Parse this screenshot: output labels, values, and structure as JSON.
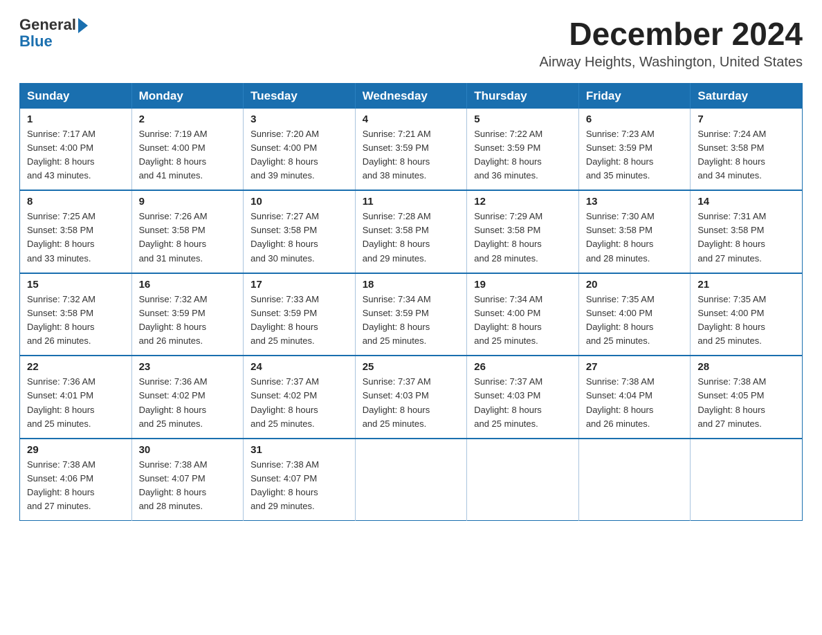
{
  "header": {
    "logo": {
      "general": "General",
      "blue": "Blue",
      "triangle": "▶"
    },
    "title": "December 2024",
    "subtitle": "Airway Heights, Washington, United States"
  },
  "calendar": {
    "days_of_week": [
      "Sunday",
      "Monday",
      "Tuesday",
      "Wednesday",
      "Thursday",
      "Friday",
      "Saturday"
    ],
    "weeks": [
      [
        {
          "day": "1",
          "sunrise": "Sunrise: 7:17 AM",
          "sunset": "Sunset: 4:00 PM",
          "daylight": "Daylight: 8 hours and 43 minutes."
        },
        {
          "day": "2",
          "sunrise": "Sunrise: 7:19 AM",
          "sunset": "Sunset: 4:00 PM",
          "daylight": "Daylight: 8 hours and 41 minutes."
        },
        {
          "day": "3",
          "sunrise": "Sunrise: 7:20 AM",
          "sunset": "Sunset: 4:00 PM",
          "daylight": "Daylight: 8 hours and 39 minutes."
        },
        {
          "day": "4",
          "sunrise": "Sunrise: 7:21 AM",
          "sunset": "Sunset: 3:59 PM",
          "daylight": "Daylight: 8 hours and 38 minutes."
        },
        {
          "day": "5",
          "sunrise": "Sunrise: 7:22 AM",
          "sunset": "Sunset: 3:59 PM",
          "daylight": "Daylight: 8 hours and 36 minutes."
        },
        {
          "day": "6",
          "sunrise": "Sunrise: 7:23 AM",
          "sunset": "Sunset: 3:59 PM",
          "daylight": "Daylight: 8 hours and 35 minutes."
        },
        {
          "day": "7",
          "sunrise": "Sunrise: 7:24 AM",
          "sunset": "Sunset: 3:58 PM",
          "daylight": "Daylight: 8 hours and 34 minutes."
        }
      ],
      [
        {
          "day": "8",
          "sunrise": "Sunrise: 7:25 AM",
          "sunset": "Sunset: 3:58 PM",
          "daylight": "Daylight: 8 hours and 33 minutes."
        },
        {
          "day": "9",
          "sunrise": "Sunrise: 7:26 AM",
          "sunset": "Sunset: 3:58 PM",
          "daylight": "Daylight: 8 hours and 31 minutes."
        },
        {
          "day": "10",
          "sunrise": "Sunrise: 7:27 AM",
          "sunset": "Sunset: 3:58 PM",
          "daylight": "Daylight: 8 hours and 30 minutes."
        },
        {
          "day": "11",
          "sunrise": "Sunrise: 7:28 AM",
          "sunset": "Sunset: 3:58 PM",
          "daylight": "Daylight: 8 hours and 29 minutes."
        },
        {
          "day": "12",
          "sunrise": "Sunrise: 7:29 AM",
          "sunset": "Sunset: 3:58 PM",
          "daylight": "Daylight: 8 hours and 28 minutes."
        },
        {
          "day": "13",
          "sunrise": "Sunrise: 7:30 AM",
          "sunset": "Sunset: 3:58 PM",
          "daylight": "Daylight: 8 hours and 28 minutes."
        },
        {
          "day": "14",
          "sunrise": "Sunrise: 7:31 AM",
          "sunset": "Sunset: 3:58 PM",
          "daylight": "Daylight: 8 hours and 27 minutes."
        }
      ],
      [
        {
          "day": "15",
          "sunrise": "Sunrise: 7:32 AM",
          "sunset": "Sunset: 3:58 PM",
          "daylight": "Daylight: 8 hours and 26 minutes."
        },
        {
          "day": "16",
          "sunrise": "Sunrise: 7:32 AM",
          "sunset": "Sunset: 3:59 PM",
          "daylight": "Daylight: 8 hours and 26 minutes."
        },
        {
          "day": "17",
          "sunrise": "Sunrise: 7:33 AM",
          "sunset": "Sunset: 3:59 PM",
          "daylight": "Daylight: 8 hours and 25 minutes."
        },
        {
          "day": "18",
          "sunrise": "Sunrise: 7:34 AM",
          "sunset": "Sunset: 3:59 PM",
          "daylight": "Daylight: 8 hours and 25 minutes."
        },
        {
          "day": "19",
          "sunrise": "Sunrise: 7:34 AM",
          "sunset": "Sunset: 4:00 PM",
          "daylight": "Daylight: 8 hours and 25 minutes."
        },
        {
          "day": "20",
          "sunrise": "Sunrise: 7:35 AM",
          "sunset": "Sunset: 4:00 PM",
          "daylight": "Daylight: 8 hours and 25 minutes."
        },
        {
          "day": "21",
          "sunrise": "Sunrise: 7:35 AM",
          "sunset": "Sunset: 4:00 PM",
          "daylight": "Daylight: 8 hours and 25 minutes."
        }
      ],
      [
        {
          "day": "22",
          "sunrise": "Sunrise: 7:36 AM",
          "sunset": "Sunset: 4:01 PM",
          "daylight": "Daylight: 8 hours and 25 minutes."
        },
        {
          "day": "23",
          "sunrise": "Sunrise: 7:36 AM",
          "sunset": "Sunset: 4:02 PM",
          "daylight": "Daylight: 8 hours and 25 minutes."
        },
        {
          "day": "24",
          "sunrise": "Sunrise: 7:37 AM",
          "sunset": "Sunset: 4:02 PM",
          "daylight": "Daylight: 8 hours and 25 minutes."
        },
        {
          "day": "25",
          "sunrise": "Sunrise: 7:37 AM",
          "sunset": "Sunset: 4:03 PM",
          "daylight": "Daylight: 8 hours and 25 minutes."
        },
        {
          "day": "26",
          "sunrise": "Sunrise: 7:37 AM",
          "sunset": "Sunset: 4:03 PM",
          "daylight": "Daylight: 8 hours and 25 minutes."
        },
        {
          "day": "27",
          "sunrise": "Sunrise: 7:38 AM",
          "sunset": "Sunset: 4:04 PM",
          "daylight": "Daylight: 8 hours and 26 minutes."
        },
        {
          "day": "28",
          "sunrise": "Sunrise: 7:38 AM",
          "sunset": "Sunset: 4:05 PM",
          "daylight": "Daylight: 8 hours and 27 minutes."
        }
      ],
      [
        {
          "day": "29",
          "sunrise": "Sunrise: 7:38 AM",
          "sunset": "Sunset: 4:06 PM",
          "daylight": "Daylight: 8 hours and 27 minutes."
        },
        {
          "day": "30",
          "sunrise": "Sunrise: 7:38 AM",
          "sunset": "Sunset: 4:07 PM",
          "daylight": "Daylight: 8 hours and 28 minutes."
        },
        {
          "day": "31",
          "sunrise": "Sunrise: 7:38 AM",
          "sunset": "Sunset: 4:07 PM",
          "daylight": "Daylight: 8 hours and 29 minutes."
        },
        null,
        null,
        null,
        null
      ]
    ]
  }
}
